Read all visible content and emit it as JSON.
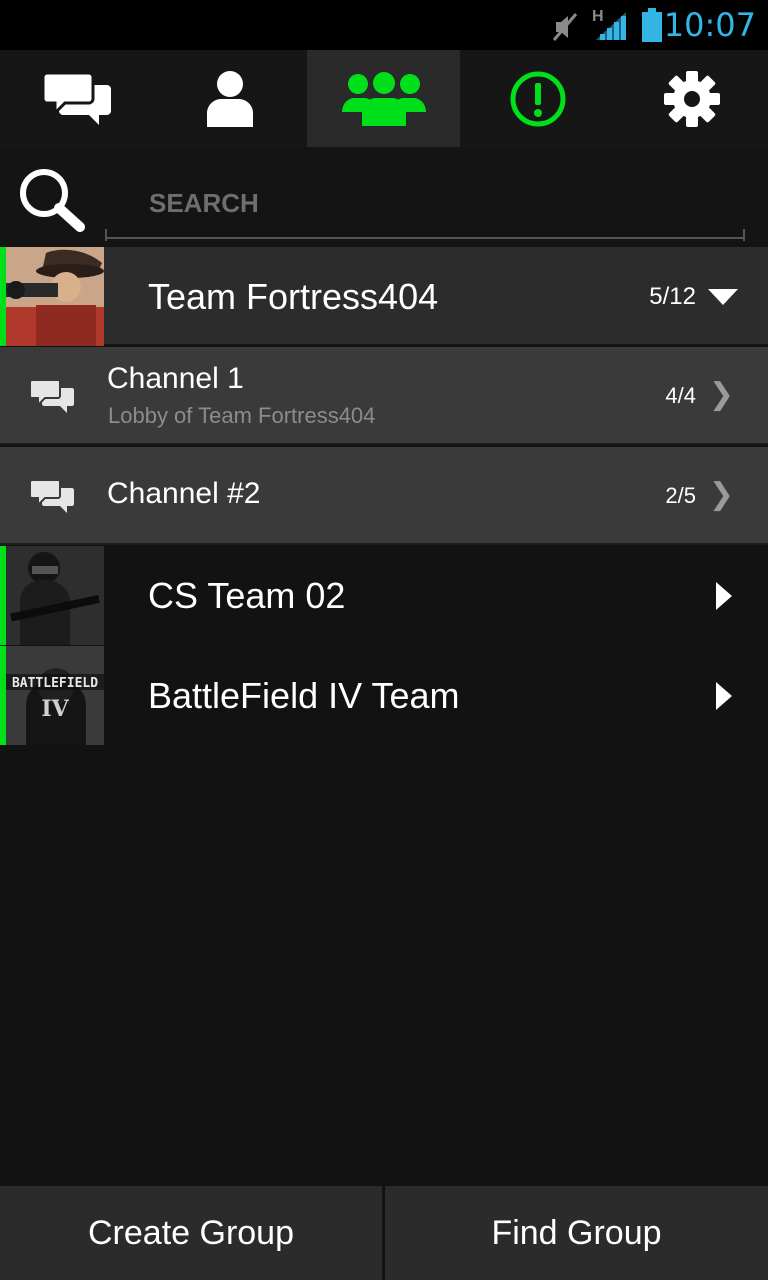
{
  "status_bar": {
    "time": "10:07",
    "network_label": "H",
    "icons": [
      "mute-icon",
      "signal-icon",
      "battery-icon"
    ],
    "time_color": "#33b5e5"
  },
  "tabs": [
    {
      "name": "messages",
      "icon": "chat-bubbles-icon",
      "active": false
    },
    {
      "name": "friends",
      "icon": "person-icon",
      "active": false
    },
    {
      "name": "groups",
      "icon": "group-icon",
      "active": true
    },
    {
      "name": "alerts",
      "icon": "alert-icon",
      "active": false
    },
    {
      "name": "settings",
      "icon": "gear-icon",
      "active": false
    }
  ],
  "search": {
    "placeholder": "SEARCH",
    "value": ""
  },
  "groups": [
    {
      "name": "Team Fortress404",
      "count": "5/12",
      "expanded": true,
      "channels": [
        {
          "name": "Channel 1",
          "subtitle": "Lobby of Team Fortress404",
          "count": "4/4"
        },
        {
          "name": "Channel #2",
          "subtitle": "",
          "count": "2/5"
        }
      ]
    },
    {
      "name": "CS Team 02",
      "count": "",
      "expanded": false
    },
    {
      "name": "BattleField IV Team",
      "count": "",
      "expanded": false
    }
  ],
  "bottom": {
    "create_label": "Create Group",
    "find_label": "Find Group"
  },
  "colors": {
    "accent": "#00e01a",
    "background": "#121212",
    "row_expanded": "#2c2c2c",
    "channel_row": "#3a3a3a"
  }
}
